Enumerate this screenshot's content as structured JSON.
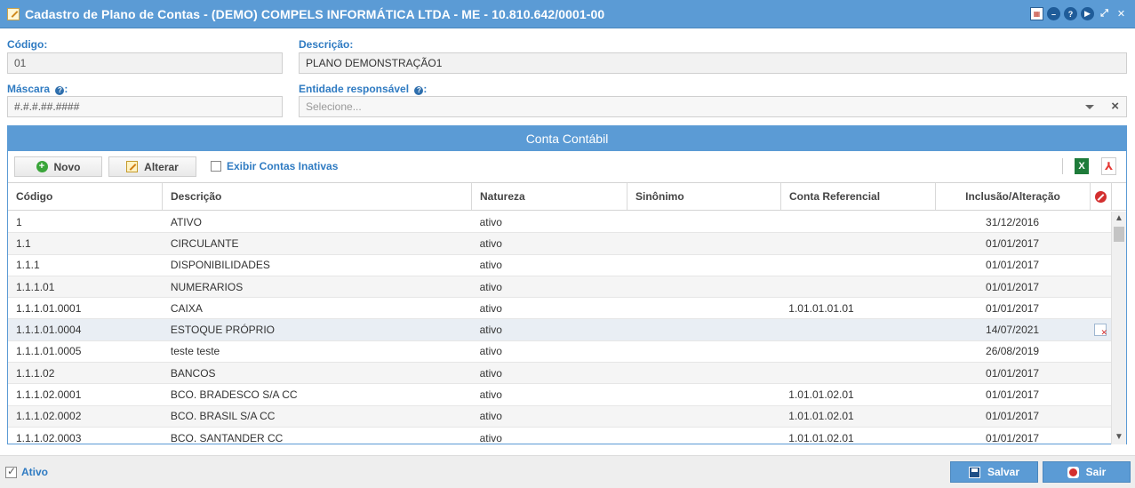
{
  "window": {
    "title": "Cadastro de Plano de Contas - (DEMO) COMPELS INFORMÁTICA LTDA - ME - 10.810.642/0001-00",
    "controls": [
      "calendar-icon",
      "minimize-icon",
      "help-icon",
      "play-icon",
      "fullscreen-icon",
      "close-icon"
    ]
  },
  "form": {
    "codigo_label": "Código:",
    "codigo_value": "01",
    "descricao_label": "Descrição:",
    "descricao_value": "PLANO DEMONSTRAÇÃO1",
    "mascara_label": "Máscara",
    "mascara_value": "#.#.#.##.####",
    "entidade_label": "Entidade responsável",
    "entidade_placeholder": "Selecione..."
  },
  "panel": {
    "title": "Conta Contábil",
    "novo_label": "Novo",
    "alterar_label": "Alterar",
    "exibir_inativas_label": "Exibir Contas Inativas",
    "columns": [
      "Código",
      "Descrição",
      "Natureza",
      "Sinônimo",
      "Conta Referencial",
      "Inclusão/Alteração"
    ]
  },
  "rows": [
    {
      "codigo": "1",
      "descricao": "ATIVO",
      "natureza": "ativo",
      "sinonimo": "",
      "referencial": "",
      "data": "31/12/2016"
    },
    {
      "codigo": "1.1",
      "descricao": "CIRCULANTE",
      "natureza": "ativo",
      "sinonimo": "",
      "referencial": "",
      "data": "01/01/2017"
    },
    {
      "codigo": "1.1.1",
      "descricao": "DISPONIBILIDADES",
      "natureza": "ativo",
      "sinonimo": "",
      "referencial": "",
      "data": "01/01/2017"
    },
    {
      "codigo": "1.1.1.01",
      "descricao": "NUMERARIOS",
      "natureza": "ativo",
      "sinonimo": "",
      "referencial": "",
      "data": "01/01/2017"
    },
    {
      "codigo": "1.1.1.01.0001",
      "descricao": "CAIXA",
      "natureza": "ativo",
      "sinonimo": "",
      "referencial": "1.01.01.01.01",
      "data": "01/01/2017"
    },
    {
      "codigo": "1.1.1.01.0004",
      "descricao": "ESTOQUE PRÓPRIO",
      "natureza": "ativo",
      "sinonimo": "",
      "referencial": "",
      "data": "14/07/2021"
    },
    {
      "codigo": "1.1.1.01.0005",
      "descricao": "teste teste",
      "natureza": "ativo",
      "sinonimo": "",
      "referencial": "",
      "data": "26/08/2019"
    },
    {
      "codigo": "1.1.1.02",
      "descricao": "BANCOS",
      "natureza": "ativo",
      "sinonimo": "",
      "referencial": "",
      "data": "01/01/2017"
    },
    {
      "codigo": "1.1.1.02.0001",
      "descricao": "BCO. BRADESCO S/A CC",
      "natureza": "ativo",
      "sinonimo": "",
      "referencial": "1.01.01.02.01",
      "data": "01/01/2017"
    },
    {
      "codigo": "1.1.1.02.0002",
      "descricao": "BCO. BRASIL S/A CC",
      "natureza": "ativo",
      "sinonimo": "",
      "referencial": "1.01.01.02.01",
      "data": "01/01/2017"
    },
    {
      "codigo": "1.1.1.02.0003",
      "descricao": "BCO. SANTANDER CC",
      "natureza": "ativo",
      "sinonimo": "",
      "referencial": "1.01.01.02.01",
      "data": "01/01/2017"
    }
  ],
  "footer": {
    "ativo_label": "Ativo",
    "salvar_label": "Salvar",
    "sair_label": "Sair"
  },
  "colors": {
    "accent": "#5b9bd5",
    "label": "#2f7bc2"
  }
}
